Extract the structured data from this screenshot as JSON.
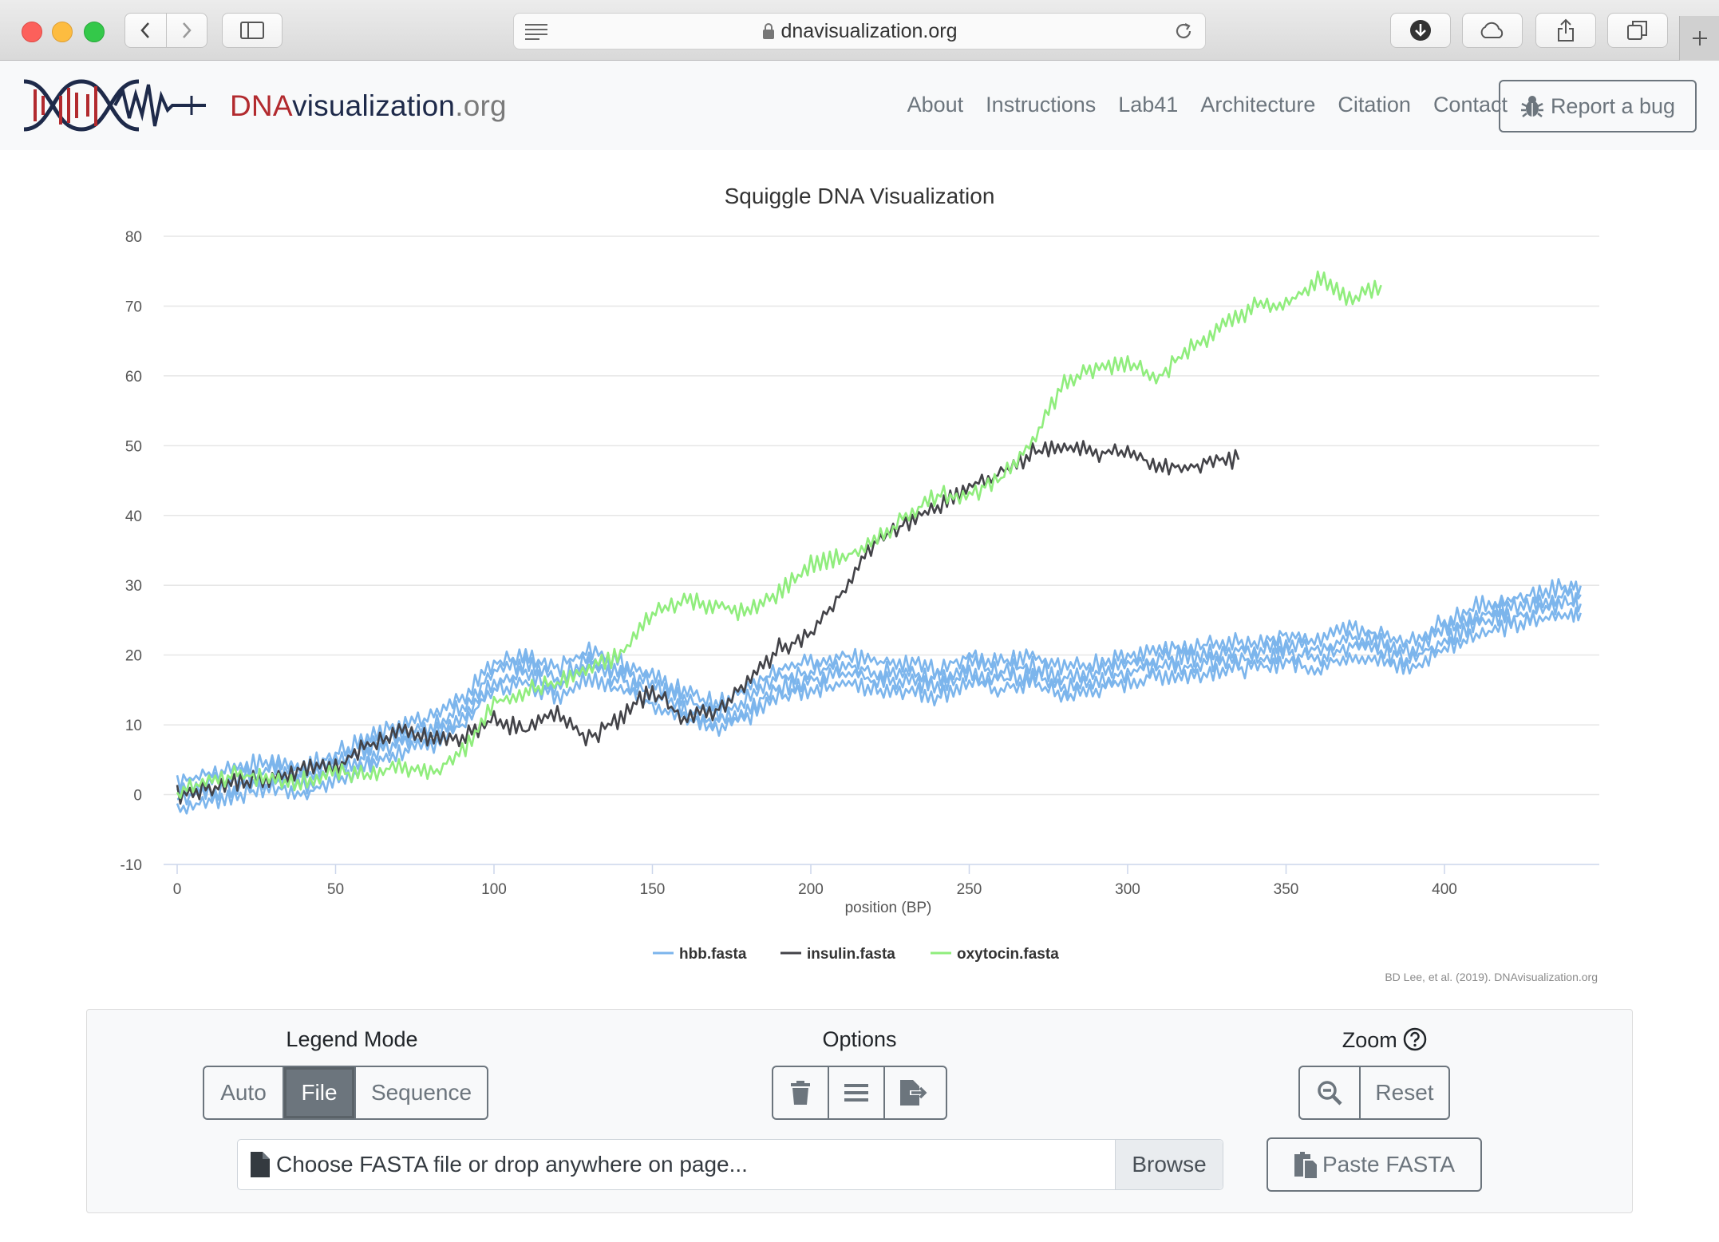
{
  "browser": {
    "url": "dnavisualization.org"
  },
  "brand": {
    "part1": "DNA",
    "part2": "visualization",
    "part3": ".org"
  },
  "nav": {
    "links": [
      "About",
      "Instructions",
      "Lab41",
      "Architecture",
      "Citation",
      "Contact"
    ],
    "report_bug": "Report a bug"
  },
  "chart_data": {
    "type": "line",
    "title": "Squiggle DNA Visualization",
    "xlabel": "position (BP)",
    "ylabel": "",
    "xlim": [
      0,
      450
    ],
    "ylim": [
      -10,
      80
    ],
    "x_ticks": [
      0,
      50,
      100,
      150,
      200,
      250,
      300,
      350,
      400
    ],
    "y_ticks": [
      80,
      70,
      60,
      50,
      40,
      30,
      20,
      10,
      0,
      -10
    ],
    "grid": true,
    "legend_position": "bottom",
    "credits": "BD Lee, et al. (2019). DNAvisualization.org",
    "series": [
      {
        "name": "hbb.fasta",
        "color": "#7cb5ec",
        "copies": 4,
        "x": [
          0,
          10,
          20,
          30,
          40,
          50,
          60,
          70,
          80,
          90,
          100,
          110,
          120,
          130,
          140,
          150,
          160,
          170,
          180,
          190,
          200,
          210,
          220,
          230,
          240,
          250,
          260,
          270,
          280,
          290,
          300,
          310,
          320,
          330,
          340,
          350,
          360,
          370,
          380,
          390,
          400,
          410,
          420,
          430,
          440,
          443
        ],
        "values": [
          0,
          1,
          2,
          3,
          2,
          4,
          6,
          8,
          9,
          12,
          17,
          18,
          16,
          19,
          17,
          15,
          13,
          11,
          13,
          16,
          17,
          18,
          17,
          17,
          16,
          18,
          17,
          18,
          16,
          17,
          18,
          19,
          19,
          20,
          20,
          21,
          20,
          22,
          21,
          20,
          23,
          25,
          26,
          27,
          28,
          28
        ]
      },
      {
        "name": "insulin.fasta",
        "color": "#434348",
        "x": [
          0,
          10,
          20,
          30,
          40,
          50,
          60,
          70,
          80,
          90,
          100,
          110,
          120,
          130,
          140,
          150,
          160,
          170,
          180,
          190,
          200,
          210,
          220,
          230,
          240,
          250,
          260,
          270,
          280,
          290,
          300,
          310,
          320,
          330,
          335
        ],
        "values": [
          0,
          1,
          2,
          2,
          4,
          4,
          7,
          9,
          8,
          8,
          11,
          9,
          12,
          8,
          11,
          15,
          11,
          12,
          16,
          21,
          23,
          29,
          36,
          39,
          41,
          44,
          46,
          49,
          50,
          49,
          49,
          47,
          47,
          48,
          48
        ]
      },
      {
        "name": "oxytocin.fasta",
        "color": "#90ed7d",
        "x": [
          0,
          10,
          20,
          30,
          40,
          50,
          60,
          70,
          80,
          90,
          100,
          110,
          120,
          130,
          140,
          150,
          160,
          170,
          180,
          190,
          200,
          210,
          220,
          230,
          240,
          250,
          260,
          270,
          280,
          290,
          300,
          310,
          320,
          330,
          340,
          350,
          360,
          370,
          380
        ],
        "values": [
          0,
          2,
          3,
          2,
          2,
          3,
          3,
          4,
          3,
          6,
          13,
          15,
          16,
          18,
          20,
          26,
          28,
          27,
          26,
          29,
          33,
          34,
          36,
          40,
          43,
          43,
          45,
          51,
          59,
          61,
          62,
          60,
          64,
          67,
          70,
          70,
          74,
          71,
          73
        ]
      }
    ]
  },
  "controls": {
    "legend_mode": {
      "title": "Legend Mode",
      "options": [
        "Auto",
        "File",
        "Sequence"
      ],
      "selected": "File"
    },
    "options": {
      "title": "Options"
    },
    "zoom": {
      "title": "Zoom",
      "reset": "Reset"
    },
    "file_input": {
      "placeholder": "Choose FASTA file or drop anywhere on page...",
      "browse": "Browse"
    },
    "paste_fasta": "Paste FASTA"
  }
}
